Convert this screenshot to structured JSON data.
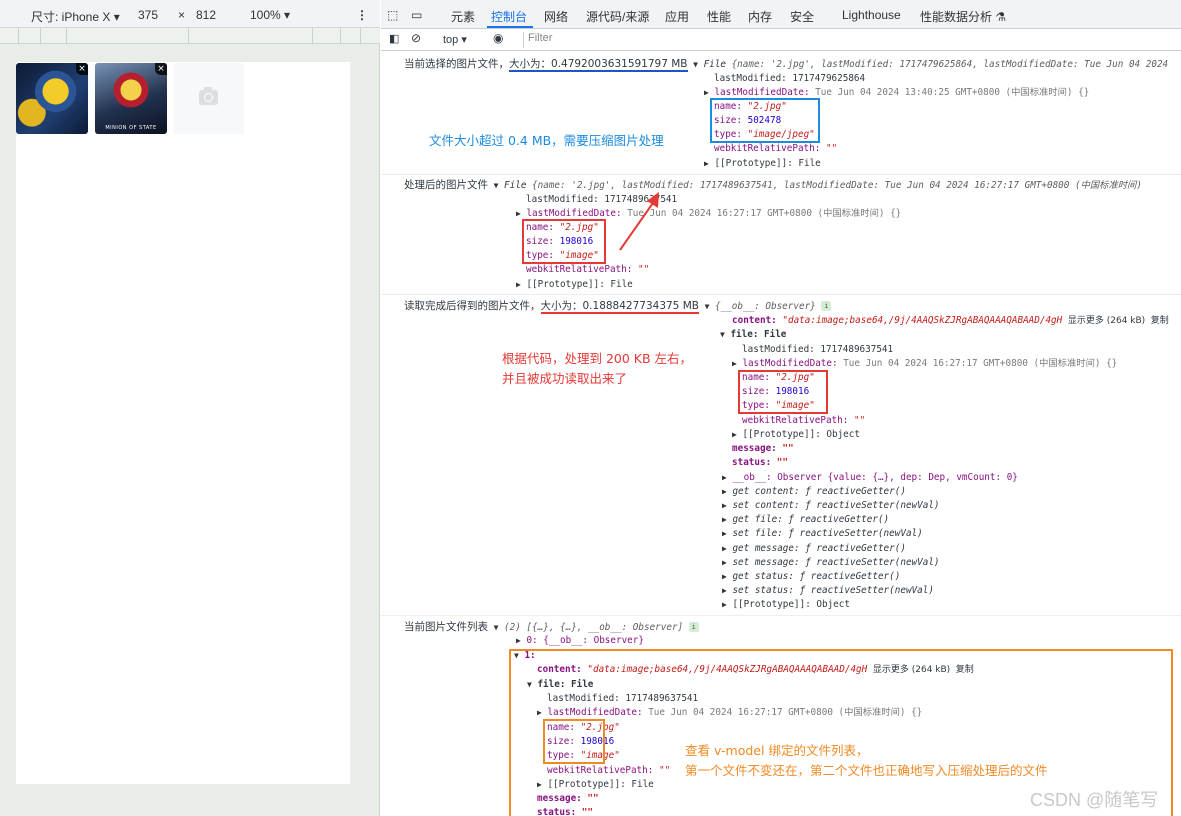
{
  "device_toolbar": {
    "dimensions_label": "尺寸: iPhone X ▾",
    "width": "375",
    "times": "×",
    "height": "812",
    "zoom": "100% ▾",
    "more": "⋮"
  },
  "thumbnails": [
    {
      "remove": "×"
    },
    {
      "remove": "×",
      "caption": "MINION OF STATE"
    }
  ],
  "devtools": {
    "tabs": [
      "元素",
      "控制台",
      "网络",
      "源代码/来源",
      "应用",
      "性能",
      "内存",
      "安全",
      "Lighthouse",
      "性能数据分析 ⚗"
    ],
    "active_tab": "控制台",
    "context": "top ▾",
    "filter_placeholder": "Filter"
  },
  "console": {
    "l1_label": "当前选择的图片文件，",
    "l1_size": "大小为：0.4792003631591797 MB",
    "l1_file": "File",
    "l1_preview": "{name: '2.jpg', lastModified: 1717479625864, lastModifiedDate: Tue Jun 04 2024",
    "l1_lastmod": "lastModified: 1717479625864",
    "l1_lastmoddate_key": "lastModifiedDate:",
    "l1_lastmoddate_val": "Tue Jun 04 2024 13:40:25 GMT+0800 (中国标准时间)  {}",
    "l1_name_key": "name:",
    "l1_name_val": "\"2.jpg\"",
    "l1_size_key": "size:",
    "l1_size_val": "502478",
    "l1_type_key": "type:",
    "l1_type_val": "\"image/jpeg\"",
    "l1_webkit_key": "webkitRelativePath:",
    "l1_webkit_val": "\"\"",
    "l1_proto": "[[Prototype]]: File",
    "l2_label": "处理后的图片文件",
    "l2_file": "File",
    "l2_preview": "{name: '2.jpg', lastModified: 1717489637541, lastModifiedDate: Tue Jun 04 2024 16:27:17 GMT+0800 (中国标准时间)",
    "l2_lastmod": "lastModified: 1717489637541",
    "l2_lastmoddate_key": "lastModifiedDate:",
    "l2_lastmoddate_val": "Tue Jun 04 2024 16:27:17 GMT+0800 (中国标准时间)  {}",
    "l2_name_key": "name:",
    "l2_name_val": "\"2.jpg\"",
    "l2_size_key": "size:",
    "l2_size_val": "198016",
    "l2_type_key": "type:",
    "l2_type_val": "\"image\"",
    "l2_webkit_key": "webkitRelativePath:",
    "l2_webkit_val": "\"\"",
    "l2_proto": "[[Prototype]]: File",
    "l3_label": "读取完成后得到的图片文件，",
    "l3_size": "大小为：0.1888427734375 MB",
    "l3_preview": "{__ob__: Observer}",
    "l3_content_key": "content:",
    "l3_content_val": "\"data:image;base64,/9j/4AAQSkZJRgABAQAAAQABAAD/4gH",
    "l3_more": "显示更多 (264 kB)",
    "l3_copy": "复制",
    "l3_file": "file: File",
    "l3_lastmod": "lastModified: 1717489637541",
    "l3_lastmoddate_key": "lastModifiedDate:",
    "l3_lastmoddate_val": "Tue Jun 04 2024 16:27:17 GMT+0800 (中国标准时间)  {}",
    "l3_name_key": "name:",
    "l3_name_val": "\"2.jpg\"",
    "l3_size_key": "size:",
    "l3_size_val": "198016",
    "l3_type_key": "type:",
    "l3_type_val": "\"image\"",
    "l3_webkit_key": "webkitRelativePath:",
    "l3_webkit_val": "\"\"",
    "l3_proto": "[[Prototype]]: Object",
    "l3_message": "message:",
    "l3_message_val": "\"\"",
    "l3_status": "status:",
    "l3_status_val": "\"\"",
    "l3_ob": "__ob__: Observer  {value: {…}, dep: Dep, vmCount: 0}",
    "l3_get_content": "get content: ƒ reactiveGetter()",
    "l3_set_content": "set content: ƒ reactiveSetter(newVal)",
    "l3_get_file": "get file: ƒ reactiveGetter()",
    "l3_set_file": "set file: ƒ reactiveSetter(newVal)",
    "l3_get_message": "get message: ƒ reactiveGetter()",
    "l3_set_message": "set message: ƒ reactiveSetter(newVal)",
    "l3_get_status": "get status: ƒ reactiveGetter()",
    "l3_set_status": "set status: ƒ reactiveSetter(newVal)",
    "l4_label": "当前图片文件列表",
    "l4_preview": "(2) [{…}, {…}, __ob__: Observer]",
    "l4_item0": "0: {__ob__: Observer}",
    "l4_item1": "1:",
    "l4_content_key": "content:",
    "l4_content_val": "\"data:image;base64,/9j/4AAQSkZJRgABAQAAAQABAAD/4gH",
    "l4_more": "显示更多 (264 kB)",
    "l4_copy": "复制",
    "l4_file": "file: File",
    "l4_lastmod": "lastModified: 1717489637541",
    "l4_lastmoddate_key": "lastModifiedDate:",
    "l4_lastmoddate_val": "Tue Jun 04 2024 16:27:17 GMT+0800 (中国标准时间)  {}",
    "l4_name_key": "name:",
    "l4_name_val": "\"2.jpg\"",
    "l4_size_key": "size:",
    "l4_size_val": "198016",
    "l4_type_key": "type:",
    "l4_type_val": "\"image\"",
    "l4_webkit_key": "webkitRelativePath:",
    "l4_webkit_val": "\"\"",
    "l4_proto": "[[Prototype]]: File",
    "l4_message": "message:",
    "l4_message_val": "\"\"",
    "l4_status": "status:",
    "l4_status_val": "\"\""
  },
  "annotations": {
    "blue_note": "文件大小超过 0.4 MB，需要压缩图片处理",
    "red_note_1": "根据代码，处理到 200 KB 左右，",
    "red_note_2": "并且被成功读取出来了",
    "orange_note_1": "查看 v-model 绑定的文件列表，",
    "orange_note_2": "第一个文件不变还在，第二个文件也正确地写入压缩处理后的文件"
  },
  "watermark": "CSDN @随笔写",
  "colors": {
    "blue": "#1a56c4",
    "red": "#e53935",
    "orange": "#f08a24",
    "active_tab": "#1a73e8"
  }
}
